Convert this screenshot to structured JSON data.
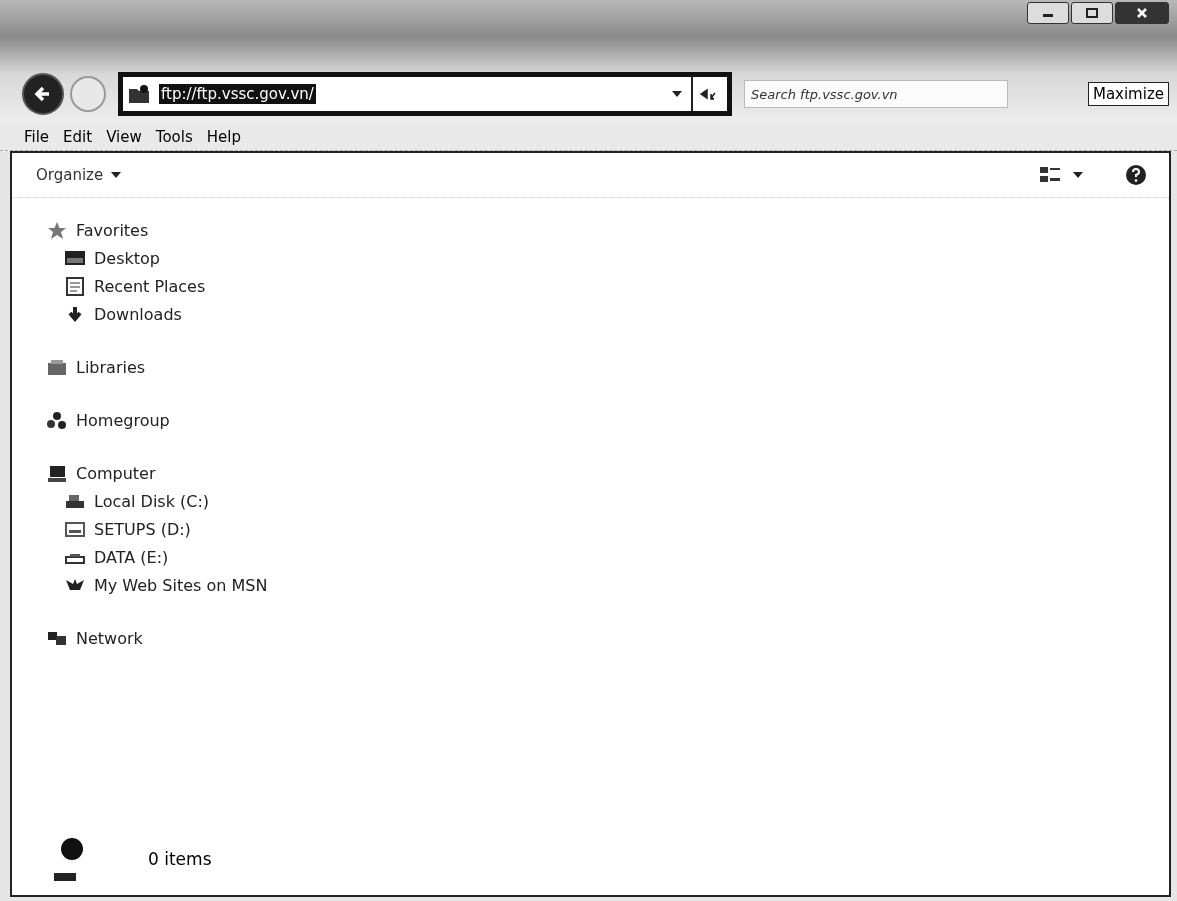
{
  "address": {
    "value": "ftp://ftp.vssc.gov.vn/",
    "selected": true
  },
  "search": {
    "placeholder": "Search ftp.vssc.gov.vn"
  },
  "tooltip": "Maximize",
  "menu": [
    "File",
    "Edit",
    "View",
    "Tools",
    "Help"
  ],
  "toolbar": {
    "organize": "Organize"
  },
  "nav": [
    {
      "label": "Favorites",
      "children": [
        {
          "label": "Desktop"
        },
        {
          "label": "Recent Places"
        },
        {
          "label": "Downloads"
        }
      ]
    },
    {
      "label": "Libraries"
    },
    {
      "label": "Homegroup"
    },
    {
      "label": "Computer",
      "children": [
        {
          "label": "Local Disk (C:)"
        },
        {
          "label": "SETUPS (D:)"
        },
        {
          "label": "DATA (E:)"
        },
        {
          "label": "My Web Sites on MSN"
        }
      ]
    },
    {
      "label": "Network"
    }
  ],
  "status": {
    "count": "0 items"
  }
}
